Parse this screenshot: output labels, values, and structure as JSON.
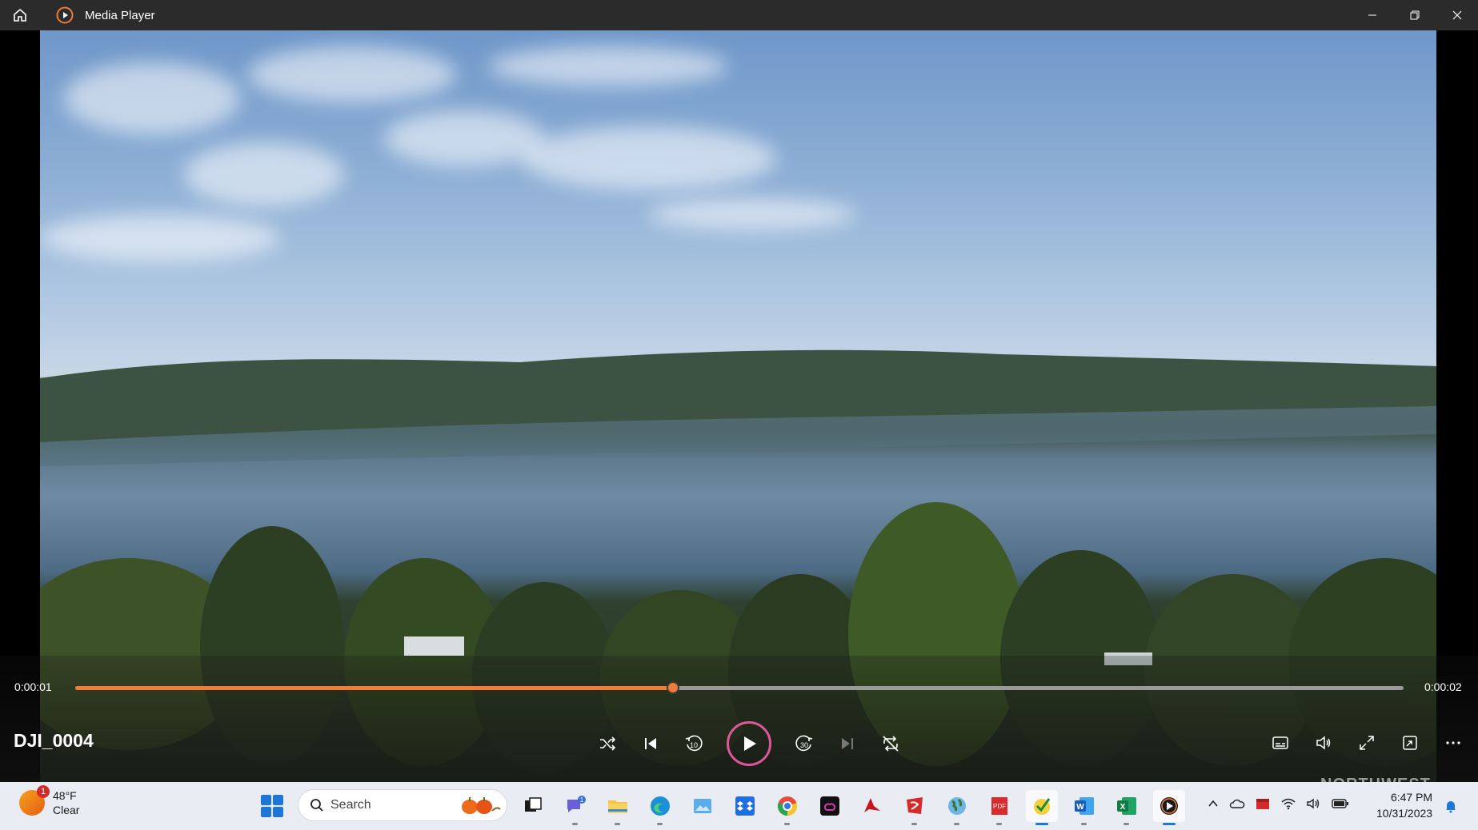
{
  "window": {
    "title": "Media Player"
  },
  "player": {
    "elapsed": "0:00:01",
    "duration": "0:00:02",
    "progress_percent": 45,
    "file_name": "DJI_0004"
  },
  "colors": {
    "accent_orange": "#f07c3a",
    "play_ring": "#e0569a",
    "titlebar": "#2b2b2b",
    "taskbar": "#e9ecf2"
  },
  "taskbar": {
    "weather": {
      "badge": "1",
      "temperature": "48°F",
      "condition": "Clear"
    },
    "search": {
      "label": "Search"
    },
    "apps": [
      {
        "name": "task-view",
        "icon": "task-view-icon"
      },
      {
        "name": "teams-chat",
        "icon": "chat-icon",
        "badge": "1"
      },
      {
        "name": "file-explorer",
        "icon": "folder-icon"
      },
      {
        "name": "edge",
        "icon": "edge-icon"
      },
      {
        "name": "photos",
        "icon": "photos-icon"
      },
      {
        "name": "dropbox",
        "icon": "dropbox-icon"
      },
      {
        "name": "chrome",
        "icon": "chrome-icon"
      },
      {
        "name": "creative-cloud",
        "icon": "creative-cloud-icon"
      },
      {
        "name": "acrobat",
        "icon": "acrobat-icon"
      },
      {
        "name": "red-app",
        "icon": "red-app-icon"
      },
      {
        "name": "globe",
        "icon": "globe-icon"
      },
      {
        "name": "pdf",
        "icon": "pdf-icon"
      },
      {
        "name": "norton",
        "icon": "check-shield-icon"
      },
      {
        "name": "word",
        "icon": "word-icon"
      },
      {
        "name": "excel",
        "icon": "excel-icon"
      },
      {
        "name": "media-player",
        "icon": "media-player-icon"
      }
    ],
    "clock": {
      "time": "6:47 PM",
      "date": "10/31/2023"
    }
  },
  "watermark": "NORTHWEST"
}
